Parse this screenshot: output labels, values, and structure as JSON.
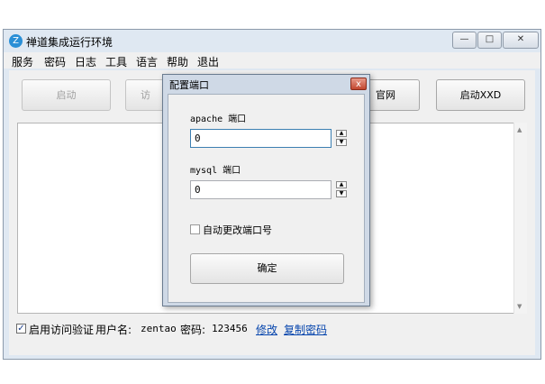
{
  "window": {
    "title": "禅道集成运行环境",
    "app_icon_glyph": "Z",
    "minimize_glyph": "—",
    "maximize_glyph": "□",
    "close_glyph": "✕"
  },
  "menu": {
    "items": [
      "服务",
      "密码",
      "日志",
      "工具",
      "语言",
      "帮助",
      "退出"
    ]
  },
  "toolbar": {
    "start_label": "启动",
    "partial_label": "访",
    "web_label": "官网",
    "start_xxd_label": "启动XXD"
  },
  "status": {
    "enable_auth_label": "启用访问验证",
    "enable_auth_checked": true,
    "check_glyph": "✓",
    "username_label": "用户名:",
    "username_value": "zentao",
    "password_label": "密码:",
    "password_value": "123456",
    "modify_link": "修改",
    "copy_password_link": "复制密码"
  },
  "dialog": {
    "title": "配置端口",
    "close_glyph": "x",
    "apache_label": "apache 端口",
    "apache_value": "0",
    "mysql_label": "mysql 端口",
    "mysql_value": "0",
    "spin_up_glyph": "▲",
    "spin_down_glyph": "▼",
    "auto_change_label": "自动更改端口号",
    "auto_change_checked": false,
    "confirm_label": "确定"
  },
  "scrollbar": {
    "up_glyph": "▲",
    "down_glyph": "▼"
  }
}
